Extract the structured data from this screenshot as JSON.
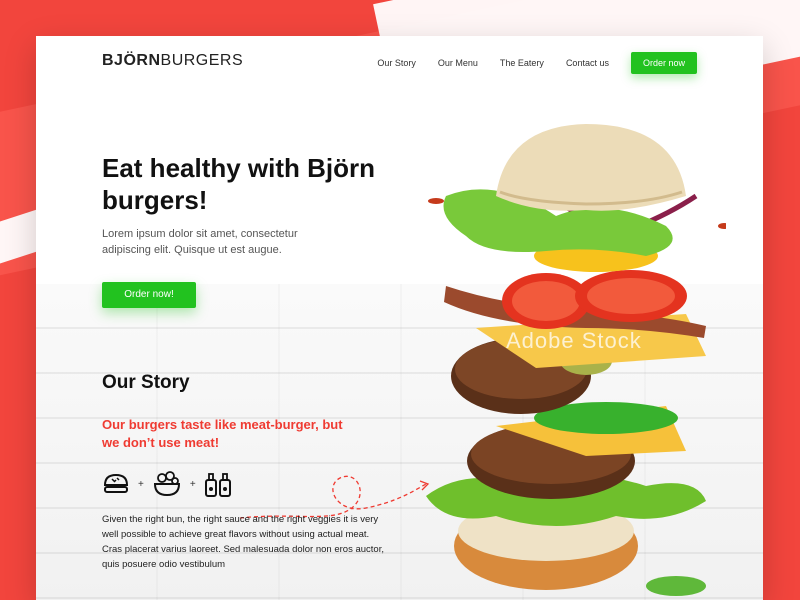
{
  "brand": {
    "strong": "BJÖRN",
    "light": "BURGERS"
  },
  "nav": {
    "items": [
      "Our Story",
      "Our Menu",
      "The Eatery",
      "Contact us"
    ],
    "cta": "Order now"
  },
  "hero": {
    "title": "Eat healthy with Björn burgers!",
    "subtitle": "Lorem ipsum dolor sit amet, consectetur adipiscing elit. Quisque ut est augue.",
    "cta": "Order now!"
  },
  "story": {
    "title": "Our Story",
    "tagline": "Our burgers taste like meat-burger, but we don’t use meat!",
    "body": "Given the right bun, the right sauce and the right veggies it is very well possible to achieve great flavors without using actual meat. Cras placerat varius laoreet. Sed malesuada dolor non eros auctor, quis posuere odio vestibulum",
    "icons": [
      "bun-icon",
      "salad-bowl-icon",
      "sauce-bottles-icon"
    ]
  },
  "watermark": "Adobe Stock",
  "colors": {
    "brand_red": "#f2453d",
    "green": "#22c21f",
    "accent_red": "#ef3b32"
  }
}
